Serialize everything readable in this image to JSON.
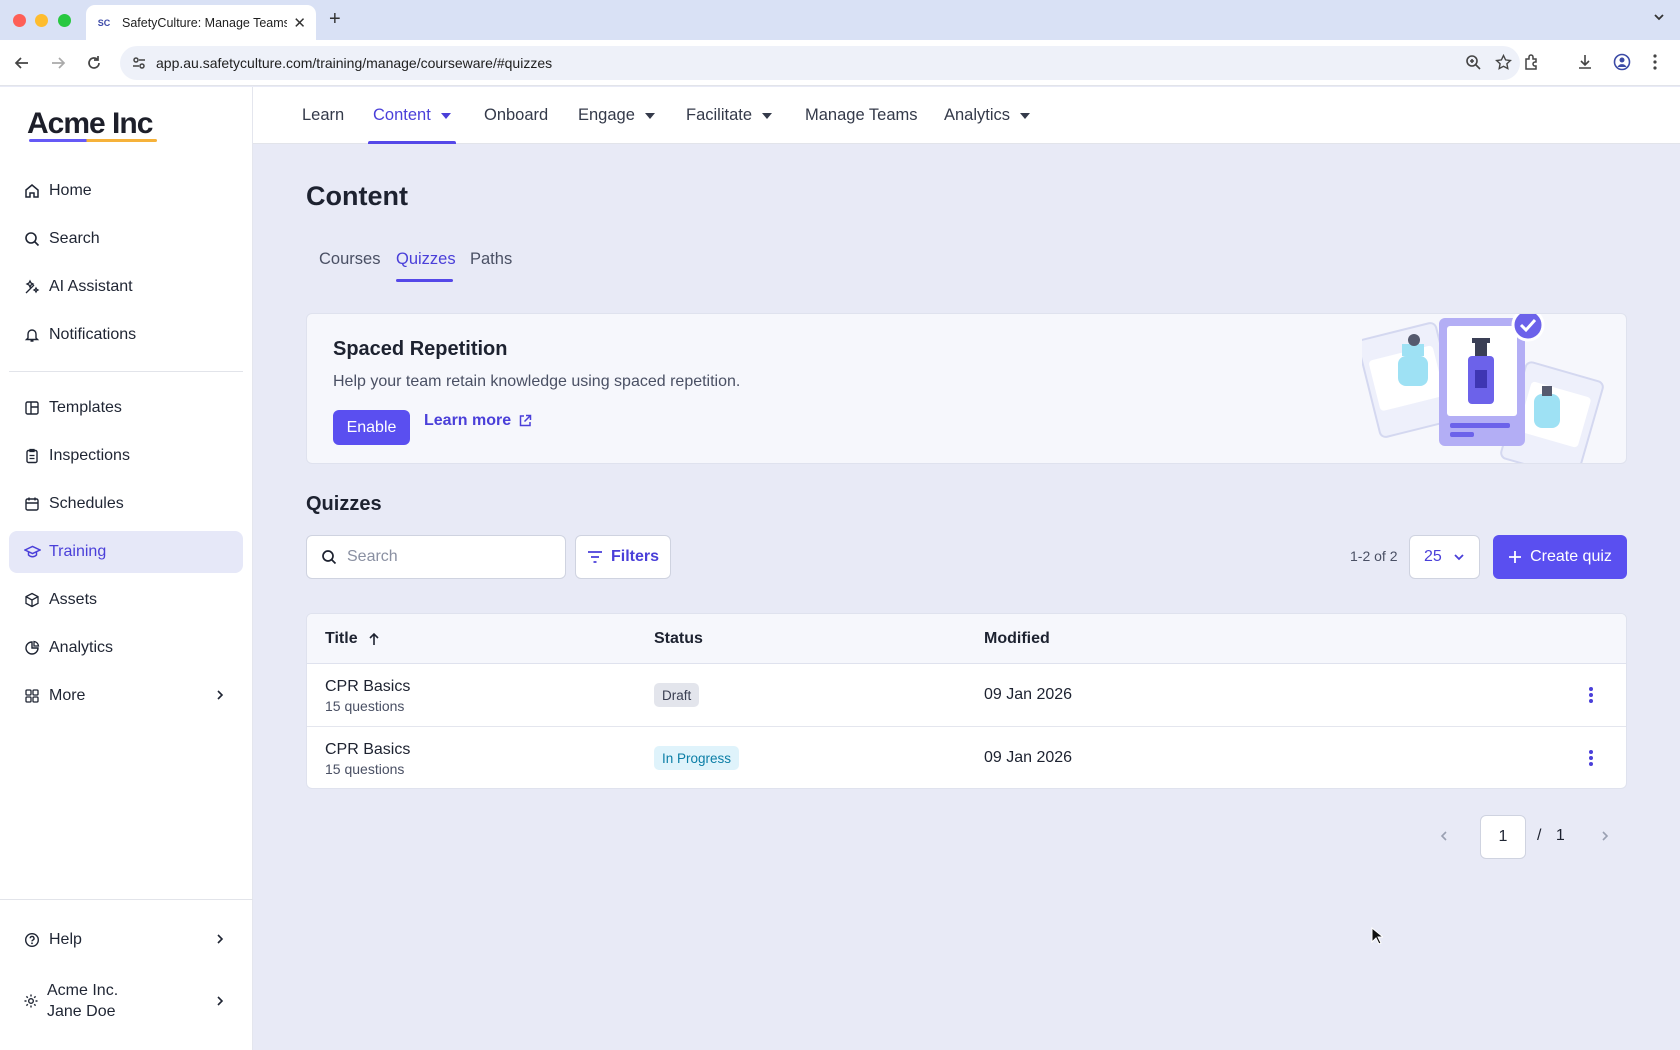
{
  "browser": {
    "tab_title": "SafetyCulture: Manage Teams",
    "tab_favicon_text": "SC",
    "url": "app.au.safetyculture.com/training/manage/courseware/#quizzes"
  },
  "sidebar": {
    "logo": "Acme Inc",
    "items": [
      {
        "label": "Home",
        "icon": "home-icon"
      },
      {
        "label": "Search",
        "icon": "search-icon"
      },
      {
        "label": "AI Assistant",
        "icon": "sparkle-icon"
      },
      {
        "label": "Notifications",
        "icon": "bell-icon"
      },
      {
        "label": "Templates",
        "icon": "template-icon"
      },
      {
        "label": "Inspections",
        "icon": "clipboard-icon"
      },
      {
        "label": "Schedules",
        "icon": "calendar-icon"
      },
      {
        "label": "Training",
        "icon": "graduation-cap-icon",
        "active": true
      },
      {
        "label": "Assets",
        "icon": "cube-icon"
      },
      {
        "label": "Analytics",
        "icon": "pie-chart-icon"
      },
      {
        "label": "More",
        "icon": "grid-icon"
      }
    ],
    "help": "Help",
    "account": {
      "org": "Acme Inc.",
      "user": "Jane Doe"
    }
  },
  "topnav": {
    "items": [
      "Learn",
      "Content",
      "Onboard",
      "Engage",
      "Facilitate",
      "Manage Teams",
      "Analytics"
    ],
    "active": "Content"
  },
  "page": {
    "title": "Content",
    "subtabs": [
      "Courses",
      "Quizzes",
      "Paths"
    ],
    "active_subtab": "Quizzes"
  },
  "banner": {
    "title": "Spaced Repetition",
    "description": "Help your team retain knowledge using spaced repetition.",
    "enable_label": "Enable",
    "learn_more_label": "Learn more"
  },
  "quizzes": {
    "section_title": "Quizzes",
    "search_placeholder": "Search",
    "filters_label": "Filters",
    "count_text": "1-2 of 2",
    "per_page": "25",
    "create_label": "Create quiz",
    "columns": {
      "title": "Title",
      "status": "Status",
      "modified": "Modified"
    },
    "rows": [
      {
        "title": "CPR Basics",
        "subtitle": "15 questions",
        "status": "Draft",
        "modified": "09 Jan 2026"
      },
      {
        "title": "CPR Basics",
        "subtitle": "15 questions",
        "status": "In Progress",
        "modified": "09 Jan 2026"
      }
    ],
    "pagination": {
      "current": "1",
      "separator": "/",
      "total": "1"
    }
  },
  "colors": {
    "accent": "#5a4ff0",
    "draft_badge_bg": "#e3e5ec",
    "in_progress_badge_bg": "#dff3fb",
    "in_progress_badge_text": "#0b7ea6"
  }
}
